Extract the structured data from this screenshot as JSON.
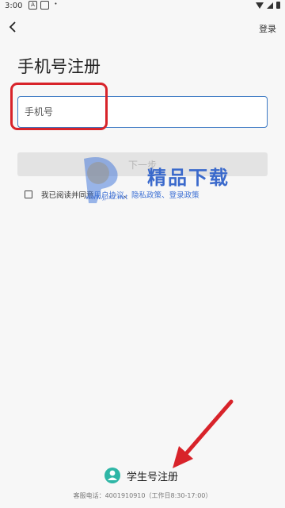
{
  "status_bar": {
    "time": "3:00",
    "icons": [
      "sim-icon",
      "notification-icon",
      "dot-icon"
    ],
    "right_icons": [
      "wifi-icon",
      "signal-icon",
      "battery-icon"
    ]
  },
  "header": {
    "back_icon": "chevron-left-icon",
    "login_label": "登录"
  },
  "page": {
    "title": "手机号注册"
  },
  "form": {
    "phone_placeholder": "手机号",
    "phone_value": "",
    "next_label": "下一步"
  },
  "agreement": {
    "prefix": "我已阅读并同意",
    "user_agreement": "用户协议",
    "separator": "、",
    "privacy_policy": "隐私政策",
    "suffix": "、登录政策"
  },
  "watermark": {
    "text": "精品下载",
    "url": "www.jpxz.net"
  },
  "student": {
    "label": "学生号注册",
    "icon": "student-icon"
  },
  "footer": {
    "text": "客服电话：4001910910（工作日8:30-17:00）"
  },
  "colors": {
    "accent": "#3a78c3",
    "highlight": "#d8232a",
    "link": "#3b6fd4",
    "student_icon": "#2fb6a6"
  }
}
